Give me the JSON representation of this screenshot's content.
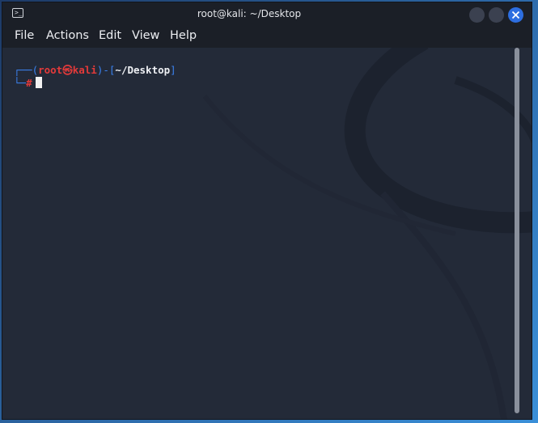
{
  "window": {
    "title": "root@kali: ~/Desktop",
    "icon": "terminal-icon"
  },
  "menu": {
    "items": [
      "File",
      "Actions",
      "Edit",
      "View",
      "Help"
    ]
  },
  "terminal": {
    "prompt": {
      "corner_top": "┌──(",
      "user": "root",
      "at_symbol": "㉿",
      "host": "kali",
      "bridge": ")-[",
      "path": "~/Desktop",
      "close_bracket": "]",
      "corner_bottom": "└─",
      "symbol": "#"
    }
  },
  "colors": {
    "accent": "#2d6ee0",
    "prompt_blue": "#3b82f0",
    "prompt_red": "#e33a3a",
    "terminal_bg": "#232a38"
  }
}
